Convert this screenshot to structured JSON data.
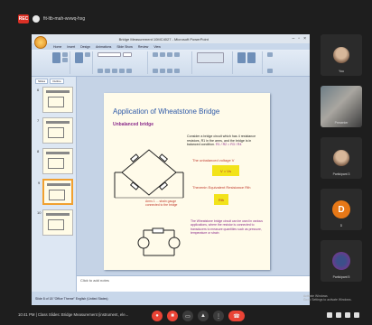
{
  "meeting": {
    "title": "fit-ltb-mah-wvwq-hxg",
    "rec_label": "REC"
  },
  "powerpoint": {
    "window_title": "Bridge Measurement 10MC4027 - Microsoft PowerPoint",
    "tabs": [
      "Home",
      "Insert",
      "Design",
      "Animations",
      "Slide Show",
      "Review",
      "View"
    ],
    "thumb_tabs": [
      "Slides",
      "Outline"
    ],
    "thumb_numbers": [
      "6",
      "7",
      "8",
      "9",
      "10"
    ],
    "notes_placeholder": "Click to add notes",
    "status_text": "Slide 8 of 18    \"Office Theme\"    English (United States)"
  },
  "slide": {
    "title": "Application of Wheatstone Bridge",
    "subtitle": "Unbalanced bridge",
    "para_start": "Consider a bridge circuit which has 4 resistance",
    "para_body": "resistors, R1 in the arms, and the bridge is in balanced condition.",
    "formula_highlight": "R1 / R2 = R3 / R4",
    "balance_label": "The unbalanced voltage V",
    "formula1": "V = Vs",
    "unknown_label": "Thevenin Equivalent Resistance Rth",
    "formula2": "Rth",
    "note": "Arms 1 ... strain gauge connected to the bridge",
    "use_para": "The Wheatstone bridge circuit can be used in various applications, where the resistor is connected to transducers to measure quantities such as pressure, temperature or strain"
  },
  "participants": [
    {
      "name": "You"
    },
    {
      "name": "Presenter"
    },
    {
      "name": "Participant 3"
    },
    {
      "name": "D",
      "letter": "D"
    },
    {
      "name": "Participant 5"
    }
  ],
  "bottom": {
    "meeting_label": "10:41 PM | Class Slides: Bridge Measurement (instrument, ele..."
  },
  "watermark": {
    "line1": "Activate Windows",
    "line2": "Go to Settings to activate Windows."
  },
  "colors": {
    "accent_red": "#ea4335",
    "slide_title": "#2f5aa8",
    "highlight_purple": "#8a2a8a"
  }
}
